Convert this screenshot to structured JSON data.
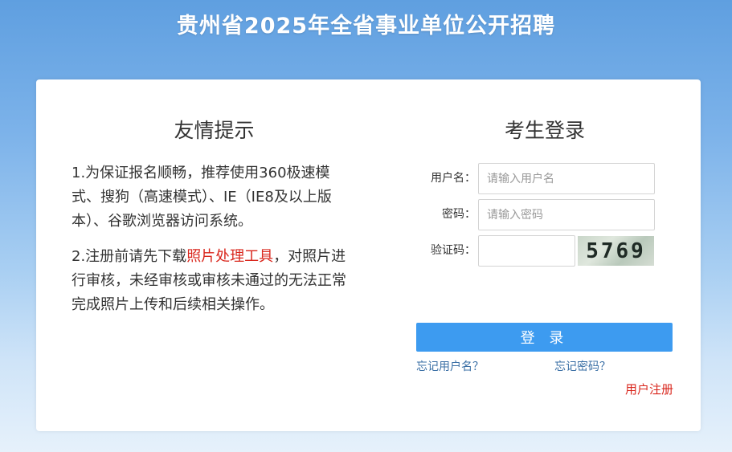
{
  "header": {
    "title": "贵州省2025年全省事业单位公开招聘"
  },
  "notice": {
    "title": "友情提示",
    "item1": "1.为保证报名顺畅，推荐使用360极速模式、搜狗（高速模式）、IE（IE8及以上版本）、谷歌浏览器访问系统。",
    "item2_before": "2.注册前请先下载",
    "item2_link": "照片处理工具",
    "item2_after": "，对照片进行审核，未经审核或审核未通过的无法正常完成照片上传和后续相关操作。"
  },
  "login": {
    "title": "考生登录",
    "username_label": "用户名：",
    "username_placeholder": "请输入用户名",
    "password_label": "密码：",
    "password_placeholder": "请输入密码",
    "captcha_label": "验证码：",
    "captcha_value": "5769",
    "submit_label": "登 录",
    "forgot_username": "忘记用户名？",
    "forgot_password": "忘记密码？",
    "register": "用户注册"
  },
  "colors": {
    "primary_button": "#3d9bf0",
    "link_red": "#d9261c",
    "link_blue": "#3a6fa5"
  }
}
